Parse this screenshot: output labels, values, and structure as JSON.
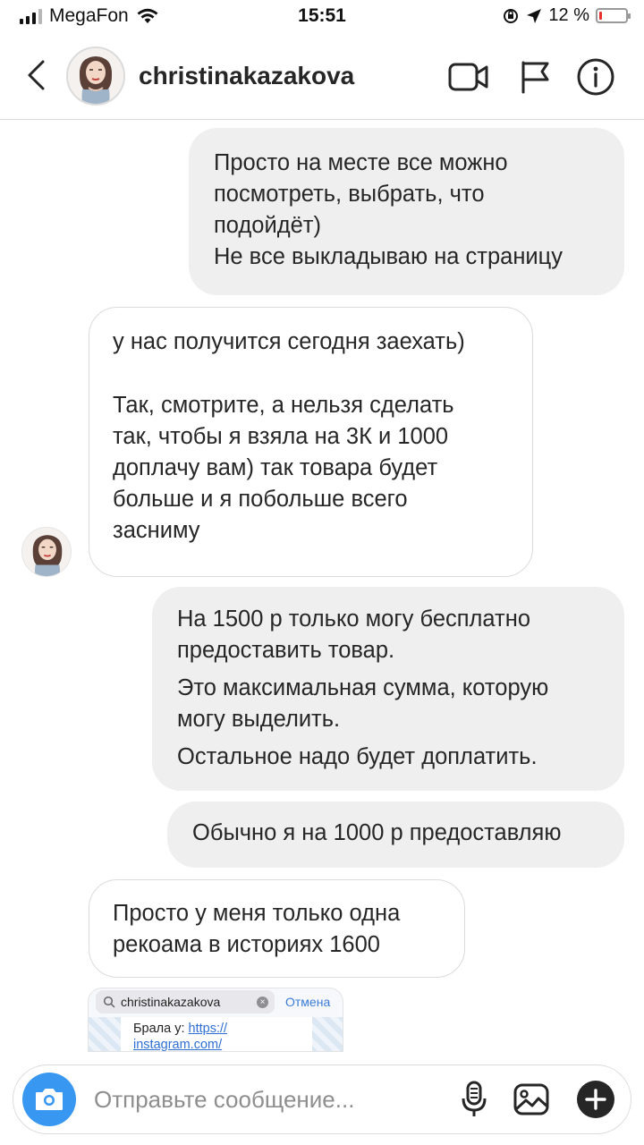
{
  "status_bar": {
    "carrier": "MegaFon",
    "time": "15:51",
    "battery_percent": "12 %",
    "battery_level": 0.12
  },
  "header": {
    "username": "christinakazakova",
    "icons": [
      "back-chevron-icon",
      "video-camera-icon",
      "flag-icon",
      "info-icon"
    ]
  },
  "messages": [
    {
      "direction": "outgoing",
      "lines": [
        "Просто на месте все можно",
        "посмотреть, выбрать, что",
        "подойдёт)",
        "Не все выкладываю на страницу"
      ]
    },
    {
      "direction": "incoming",
      "lines": [
        "у нас получится сегодня заехать)",
        "",
        "Так, смотрите, а нельзя сделать",
        "так, чтобы я взяла на 3К и 1000",
        "доплачу вам) так товара будет",
        "больше и я побольше всего",
        "засниму"
      ]
    },
    {
      "direction": "outgoing",
      "lines": [
        "На 1500 р только могу бесплатно",
        "предоставить товар.",
        "Это максимальная сумма, которую",
        "могу выделить.",
        "Остальное надо будет доплатить."
      ]
    },
    {
      "direction": "outgoing",
      "lines": [
        "Обычно я на 1000 р предоставляю"
      ]
    },
    {
      "direction": "incoming",
      "lines": [
        "Просто у меня только одна",
        "рекоама в историях 1600"
      ]
    }
  ],
  "shared_screenshot": {
    "search_text": "christinakazakova",
    "cancel_label": "Отмена",
    "body_prefix": "Брала у: ",
    "link_line1": "https://",
    "link_line2": "instagram.com/"
  },
  "composer": {
    "placeholder": "Отправьте сообщение...",
    "icons": [
      "camera-icon",
      "microphone-icon",
      "gallery-icon",
      "add-icon"
    ]
  },
  "colors": {
    "outgoing_bubble": "#efefef",
    "incoming_border": "#dbdbdb",
    "camera_button": "#3897f0",
    "battery_low": "#e8312f"
  }
}
